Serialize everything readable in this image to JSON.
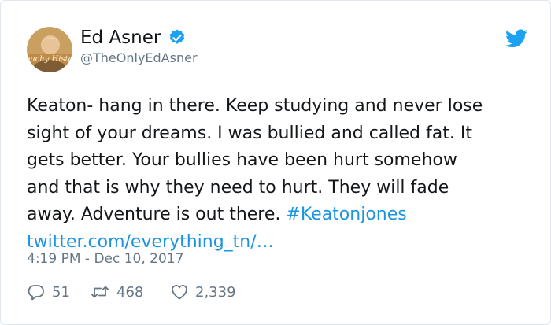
{
  "tweet": {
    "author": {
      "display_name": "Ed Asner",
      "handle": "@TheOnlyEdAsner",
      "verified": true,
      "avatar_caption": "Grouchy Historia"
    },
    "text_lines": [
      "Keaton- hang in there. Keep studying and never lose",
      "sight of your dreams. I was bullied and called fat. It",
      "gets better. Your bullies have been hurt somehow",
      "and that is why they need to hurt. They will fade",
      "away. Adventure is out there. "
    ],
    "hashtag": "#Keatonjones",
    "link": "twitter.com/everything_tn/…",
    "timestamp": "4:19 PM - Dec 10, 2017",
    "stats": {
      "replies": "51",
      "retweets": "468",
      "likes": "2,339"
    }
  },
  "icons": {
    "verified": "verified-badge-icon",
    "brand": "twitter-bird-icon",
    "reply": "reply-icon",
    "retweet": "retweet-icon",
    "like": "heart-icon"
  },
  "colors": {
    "text": "#14171a",
    "secondary": "#657786",
    "link": "#1b95e0",
    "brand": "#1da1f2",
    "border": "#e1e8ed"
  }
}
